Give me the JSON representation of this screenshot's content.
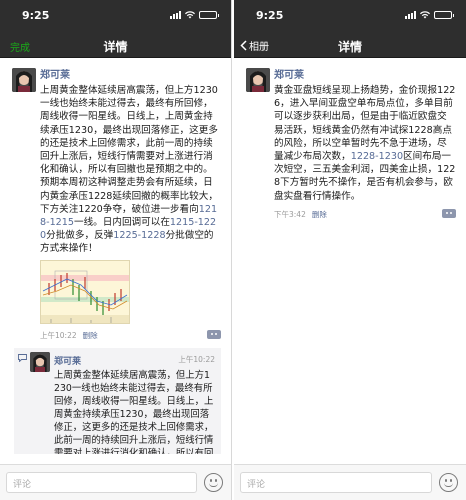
{
  "status": {
    "time": "9:25"
  },
  "left": {
    "nav": {
      "done_label": "完成",
      "title": "详情"
    },
    "post": {
      "author": "郑可莱",
      "text_segments": [
        {
          "t": "上周黄金整体延续居高震荡，但上方1230一线也始终未能过得去，最终有所回修，周线收得一阳星线。日线上，上周黄金持续承压1230，最终出现回落修正，这更多的还是技术上回修需求，此前一周的持续回升上涨后，短线行情需要对上涨进行消化和确认，所以有回撤也是预期之中的。预期本周初这种调整走势会有所延续，日内黄金承压1228延续回撤的概率比较大，下方关注1220争夺，破位进一步看向",
          "hl": false
        },
        {
          "t": "1218-1215",
          "hl": true
        },
        {
          "t": "一线。日内回调可以在",
          "hl": false
        },
        {
          "t": "1215-1220",
          "hl": true
        },
        {
          "t": "分批做多，反弹",
          "hl": false
        },
        {
          "t": "1225-1228",
          "hl": true
        },
        {
          "t": "分批做空的方式来操作！",
          "hl": false
        }
      ],
      "time": "上午10:22",
      "delete_label": "删除"
    },
    "comment": {
      "author": "郑可莱",
      "time": "上午10:22",
      "text": "上周黄金整体延续居高震荡，但上方1230一线也始终未能过得去，最终有所回修，周线收得一阳星线。日线上，上周黄金持续承压1230，最终出现回落修正，这更多的还是技术上回修需求，此前一周的持续回升上涨后，短线行情需要对上涨进行消化和确认，所以有回撤也是预期之中的。预期本周初这种调整"
    },
    "input": {
      "placeholder": "评论"
    }
  },
  "right": {
    "nav": {
      "back_label": "相册",
      "title": "详情"
    },
    "post": {
      "author": "郑可莱",
      "text_segments": [
        {
          "t": "黄金亚盘短线呈现上扬趋势，金价现报1226，进入早间亚盘空单布局点位，多单目前可以逐步获利出局，但是由于临近欧盘交易活跃，短线黄金仍然有冲试探1228高点的风险，所以空单暂时先不急于进场，尽量减少布局次数，",
          "hl": false
        },
        {
          "t": "1228-1230",
          "hl": true
        },
        {
          "t": "区间布局一次短空，三五美金利润，四美金止损，1228下方暂时先不操作，是否有机会参与，欧盘实盘看行情操作。",
          "hl": false
        }
      ],
      "time": "下午3:42",
      "delete_label": "删除"
    },
    "input": {
      "placeholder": "评论"
    }
  },
  "colors": {
    "link": "#576b95",
    "done": "#1aad19",
    "bar": "#2e2e2e"
  }
}
